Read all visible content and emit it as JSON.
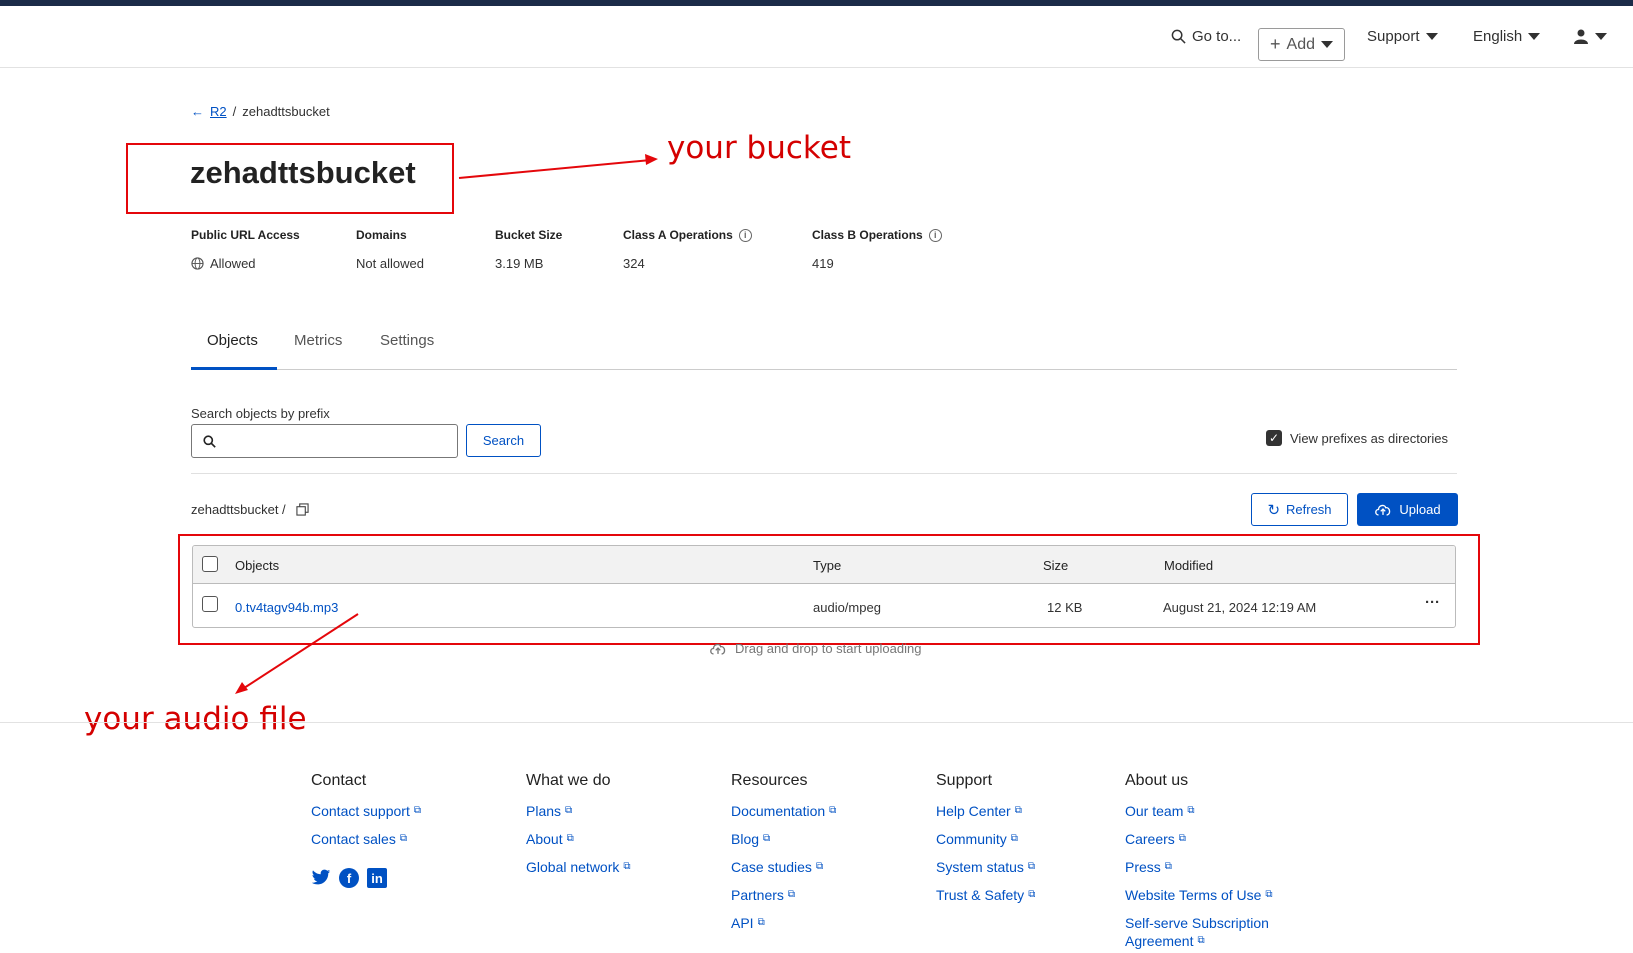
{
  "topbar": {
    "goto_label": "Go to...",
    "add_label": "Add",
    "support_label": "Support",
    "language_label": "English"
  },
  "breadcrumb": {
    "parent": "R2",
    "separator": "/",
    "current": "zehadttsbucket"
  },
  "bucket": {
    "title": "zehadttsbucket",
    "stats": [
      {
        "label": "Public URL Access",
        "value": "Allowed"
      },
      {
        "label": "Domains",
        "value": "Not allowed"
      },
      {
        "label": "Bucket Size",
        "value": "3.19 MB"
      },
      {
        "label": "Class A Operations",
        "value": "324"
      },
      {
        "label": "Class B Operations",
        "value": "419"
      }
    ]
  },
  "annotations": {
    "bucket_note": "your bucket",
    "audio_note": "your audio file"
  },
  "tabs": [
    "Objects",
    "Metrics",
    "Settings"
  ],
  "search": {
    "label": "Search objects by prefix",
    "button": "Search",
    "placeholder": ""
  },
  "view_prefixes_label": "View prefixes as directories",
  "path": "zehadttsbucket /",
  "actions": {
    "refresh": "Refresh",
    "upload": "Upload"
  },
  "table": {
    "headers": [
      "Objects",
      "Type",
      "Size",
      "Modified"
    ],
    "rows": [
      {
        "name": "0.tv4tagv94b.mp3",
        "type": "audio/mpeg",
        "size": "12 KB",
        "modified": "August 21, 2024 12:19 AM",
        "menu": "···"
      }
    ]
  },
  "drag_drop": "Drag and drop to start uploading",
  "footer": {
    "contact": {
      "title": "Contact",
      "links": [
        "Contact support",
        "Contact sales"
      ]
    },
    "what_we_do": {
      "title": "What we do",
      "links": [
        "Plans",
        "About",
        "Global network"
      ]
    },
    "resources": {
      "title": "Resources",
      "links": [
        "Documentation",
        "Blog",
        "Case studies",
        "Partners",
        "API"
      ]
    },
    "support": {
      "title": "Support",
      "links": [
        "Help Center",
        "Community",
        "System status",
        "Trust & Safety"
      ]
    },
    "about_us": {
      "title": "About us",
      "links": [
        "Our team",
        "Careers",
        "Press",
        "Website Terms of Use",
        "Self-serve Subscription",
        "Agreement"
      ]
    }
  },
  "colors": {
    "accent": "#0051c3",
    "annotation": "#e4070b",
    "topstrip": "#1b2b48"
  }
}
